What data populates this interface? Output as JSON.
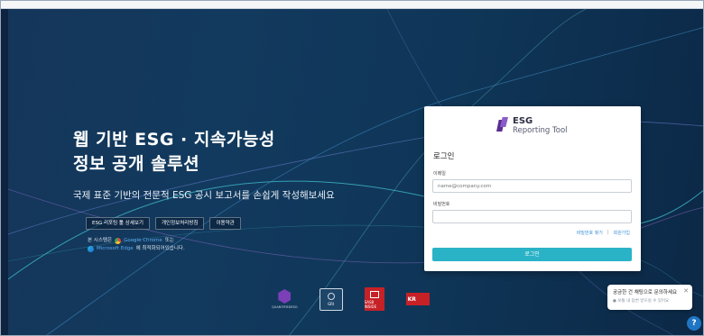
{
  "hero": {
    "headline_line1": "웹 기반 ESG · 지속가능성",
    "headline_line2": "정보 공개 솔루션",
    "subline": "국제 표준 기반의 전문적 ESG 공시 보고서를 손쉽게 작성해보세요",
    "buttons": [
      "ESG 리포팅 툴 상세보기",
      "개인정보처리방침",
      "이용약관"
    ],
    "browser_note_line1_pre": "본 시스템은",
    "browser_note_chrome": "Google Chrome",
    "browser_note_line1_post": "또는",
    "browser_note_edge": "Microsoft Edge",
    "browser_note_line2_post": "에 최적화되어있습니다."
  },
  "login": {
    "logo_line1": "ESG",
    "logo_line2": "Reporting Tool",
    "title": "로그인",
    "email_label": "이메일",
    "email_placeholder": "name@company.com",
    "password_label": "비밀번호",
    "password_placeholder": "",
    "find_password": "비밀번호 찾기",
    "separator": "|",
    "signup": "회원가입",
    "submit": "로그인"
  },
  "partners": {
    "quantified_name": "QUANTIFIEDESG",
    "gri_text": "GRI",
    "sasb_text": "SASB INSIDE",
    "kr_text": "KR"
  },
  "chat": {
    "title": "궁금한 건 채팅으로 문의하세요",
    "subtitle": "● 보통 내 답변 받으실 수 있어요",
    "close": "✕",
    "help_icon": "?"
  },
  "colors": {
    "accent": "#2ab3c7",
    "brand_purple": "#5b2d8e",
    "link": "#3a8fd6"
  }
}
